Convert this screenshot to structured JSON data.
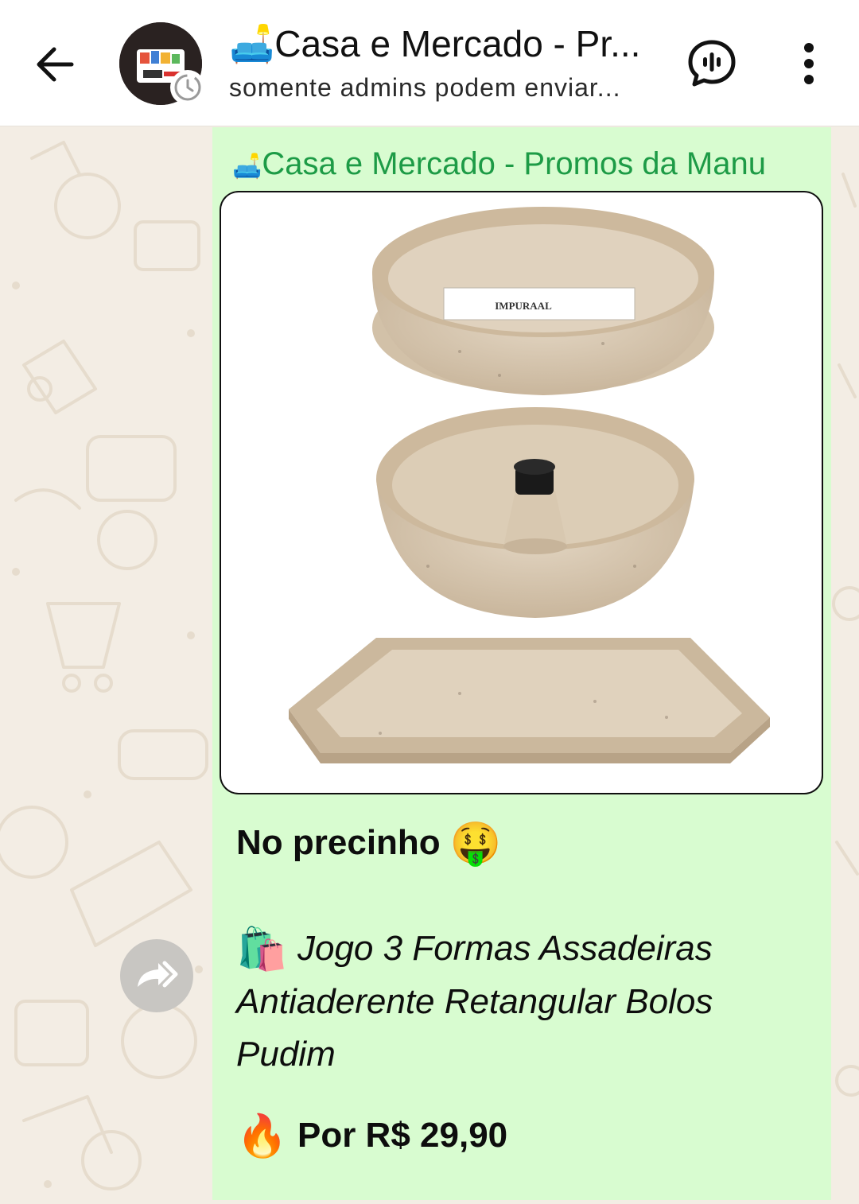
{
  "header": {
    "title": "🛋️Casa e Mercado - Pr...",
    "subtitle": "somente admins podem enviar..."
  },
  "message": {
    "sender_emoji": "🛋️",
    "sender_name": "Casa e Mercado - Promos da Manu",
    "headline": "No precinho",
    "headline_emoji": "🤑",
    "product_emoji": "🛍️",
    "product_text": "Jogo 3 Formas Assadeiras Antiaderente Retangular Bolos Pudim",
    "price_emoji": "🔥",
    "price_text": "Por R$ 29,90",
    "image_label": "IMPURAAL"
  },
  "colors": {
    "sender": "#1d9b46",
    "bubble": "#d8fcd0",
    "wallpaper": "#f3ede4",
    "pan": "#d8c8b2"
  }
}
